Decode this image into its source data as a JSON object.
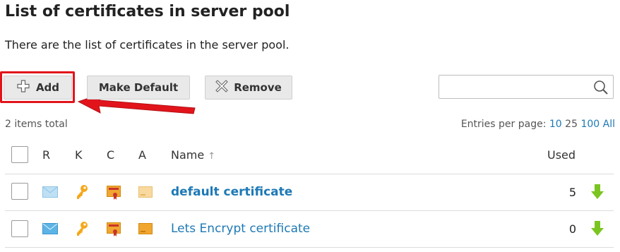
{
  "page": {
    "title": "List of certificates in server pool",
    "description": "There are the list of certificates in the server pool."
  },
  "toolbar": {
    "add_label": "Add",
    "make_default_label": "Make Default",
    "remove_label": "Remove"
  },
  "search": {
    "value": "",
    "placeholder": ""
  },
  "summary": {
    "total": "2 items total",
    "entries_label": "Entries per page:",
    "page_sizes": [
      "10",
      "25",
      "100",
      "All"
    ]
  },
  "table": {
    "headers": {
      "r": "R",
      "k": "K",
      "c": "C",
      "a": "A",
      "name": "Name",
      "sort_indicator": "↑",
      "used": "Used"
    },
    "rows": [
      {
        "name": "default certificate",
        "used": "5",
        "bold": true
      },
      {
        "name": "Lets Encrypt certificate",
        "used": "0",
        "bold": false
      }
    ]
  },
  "colors": {
    "link": "#1d79b5",
    "highlight": "#e2141b",
    "key_icon": "#f5a81d",
    "cert_icon": "#f0a630",
    "download_arrow": "#7bc520"
  },
  "icons": {
    "add": "plus-icon",
    "remove": "x-icon",
    "search": "magnifier-icon",
    "r": "envelope-icon",
    "k": "key-icon",
    "c": "certificate-icon",
    "a": "ca-card-icon",
    "used_action": "download-arrow-icon"
  }
}
